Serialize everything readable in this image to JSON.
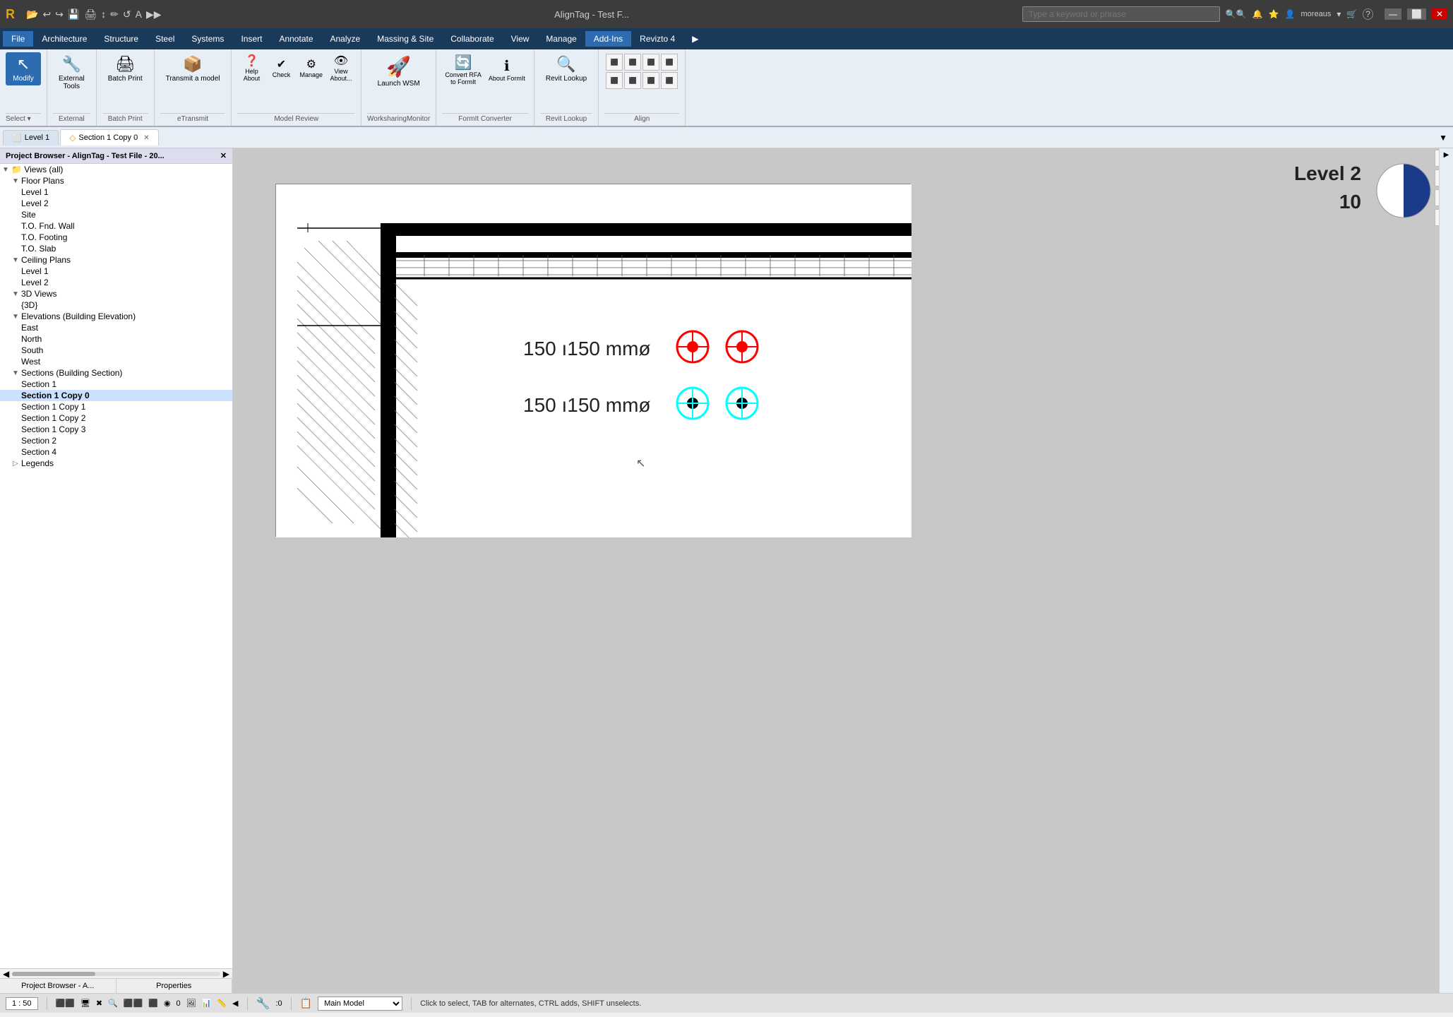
{
  "titleBar": {
    "logo": "R",
    "quickAccessIcons": [
      "↩",
      "↪",
      "🖫",
      "🖨",
      "↕",
      "✏",
      "↺",
      "A",
      "▶▶"
    ],
    "title": "AlignTag - Test F... ",
    "searchPlaceholder": "Type a keyword or phrase",
    "userIcons": [
      "🔍🔍",
      "🔔",
      "⭐",
      "👤",
      "moreaus",
      "▾",
      "🛒",
      "?",
      "—",
      "⬜",
      "✕"
    ],
    "windowControls": [
      "—",
      "⬜",
      "✕"
    ]
  },
  "menuBar": {
    "items": [
      "File",
      "Architecture",
      "Structure",
      "Steel",
      "Systems",
      "Insert",
      "Annotate",
      "Analyze",
      "Massing & Site",
      "Collaborate",
      "View",
      "Manage",
      "Add-Ins",
      "Revizto 4",
      "▶"
    ]
  },
  "ribbon": {
    "activeTab": "Add-Ins",
    "groups": [
      {
        "name": "modify",
        "label": "Select",
        "buttons": [
          {
            "icon": "⬆",
            "label": "Modify",
            "active": true
          }
        ],
        "dropdownLabel": "Select ▾"
      },
      {
        "name": "external",
        "label": "External",
        "buttons": [
          {
            "icon": "🔧",
            "label": "External\nTools"
          }
        ]
      },
      {
        "name": "batchprint",
        "label": "Batch Print",
        "buttons": [
          {
            "icon": "🖨",
            "label": "Batch Print"
          }
        ]
      },
      {
        "name": "etransmit",
        "label": "eTransmit",
        "buttons": [
          {
            "icon": "📦",
            "label": "Transmit a model"
          }
        ]
      },
      {
        "name": "modelreview",
        "label": "Model Review",
        "buttons": [
          {
            "icon": "❓",
            "label": "Help\nAbout"
          },
          {
            "icon": "✔",
            "label": "Check"
          },
          {
            "icon": "⚙",
            "label": "Manage"
          },
          {
            "icon": "👁",
            "label": "View\nAbout..."
          }
        ]
      },
      {
        "name": "worksharingmonitor",
        "label": "WorksharingMonitor",
        "buttons": [
          {
            "icon": "🚀",
            "label": "Launch WSM"
          }
        ]
      },
      {
        "name": "formitconverter",
        "label": "FormIt Converter",
        "buttons": [
          {
            "icon": "🔄",
            "label": "Convert RFA\nto FormIt"
          },
          {
            "icon": "ℹ",
            "label": "About FormIt"
          }
        ]
      },
      {
        "name": "revitlookup",
        "label": "Revit Lookup",
        "buttons": [
          {
            "icon": "🔍",
            "label": "Revit Lookup"
          }
        ]
      },
      {
        "name": "align",
        "label": "Align",
        "buttons": [
          {
            "icon": "⬛",
            "label": ""
          },
          {
            "icon": "⬛",
            "label": ""
          }
        ]
      }
    ]
  },
  "projectBrowser": {
    "title": "Project Browser - AlignTag - Test File - 20...",
    "tree": [
      {
        "level": 0,
        "type": "expand",
        "text": "Views (all)",
        "icon": "▼"
      },
      {
        "level": 1,
        "type": "expand",
        "text": "Floor Plans",
        "icon": "▼"
      },
      {
        "level": 2,
        "type": "leaf",
        "text": "Level 1"
      },
      {
        "level": 2,
        "type": "leaf",
        "text": "Level 2"
      },
      {
        "level": 2,
        "type": "leaf",
        "text": "Site"
      },
      {
        "level": 2,
        "type": "leaf",
        "text": "T.O. Fnd. Wall"
      },
      {
        "level": 2,
        "type": "leaf",
        "text": "T.O. Footing"
      },
      {
        "level": 2,
        "type": "leaf",
        "text": "T.O. Slab"
      },
      {
        "level": 1,
        "type": "expand",
        "text": "Ceiling Plans",
        "icon": "▼"
      },
      {
        "level": 2,
        "type": "leaf",
        "text": "Level 1"
      },
      {
        "level": 2,
        "type": "leaf",
        "text": "Level 2"
      },
      {
        "level": 1,
        "type": "expand",
        "text": "3D Views",
        "icon": "▼"
      },
      {
        "level": 2,
        "type": "leaf",
        "text": "{3D}"
      },
      {
        "level": 1,
        "type": "expand",
        "text": "Elevations (Building Elevation)",
        "icon": "▼"
      },
      {
        "level": 2,
        "type": "leaf",
        "text": "East"
      },
      {
        "level": 2,
        "type": "leaf",
        "text": "North"
      },
      {
        "level": 2,
        "type": "leaf",
        "text": "South"
      },
      {
        "level": 2,
        "type": "leaf",
        "text": "West"
      },
      {
        "level": 1,
        "type": "expand",
        "text": "Sections (Building Section)",
        "icon": "▼"
      },
      {
        "level": 2,
        "type": "leaf",
        "text": "Section 1"
      },
      {
        "level": 2,
        "type": "leaf",
        "text": "Section 1 Copy 0",
        "bold": true,
        "selected": true
      },
      {
        "level": 2,
        "type": "leaf",
        "text": "Section 1 Copy 1"
      },
      {
        "level": 2,
        "type": "leaf",
        "text": "Section 1 Copy 2"
      },
      {
        "level": 2,
        "type": "leaf",
        "text": "Section 1 Copy 3"
      },
      {
        "level": 2,
        "type": "leaf",
        "text": "Section 2"
      },
      {
        "level": 2,
        "type": "leaf",
        "text": "Section 4"
      },
      {
        "level": 1,
        "type": "expand",
        "text": "Legends",
        "icon": "▷"
      }
    ],
    "tabs": [
      "Project Browser - A...",
      "Properties"
    ]
  },
  "viewTabs": [
    {
      "label": "Level 1",
      "icon": "⬜",
      "active": false
    },
    {
      "label": "Section 1 Copy 0",
      "icon": "◇",
      "active": true,
      "closable": true
    }
  ],
  "canvas": {
    "levelLabel": "Level 2",
    "levelNumber": "10",
    "annotation1": "150 ı150 mmø",
    "annotation2": "150 ı150 mmø",
    "scale": "1 : 50"
  },
  "statusBar": {
    "scale": "1 : 50",
    "icons": [
      "⬛⬛",
      "🖥",
      "✖",
      "🔍",
      "⬛⬛",
      "⬛",
      "◉",
      "0",
      "🖼",
      "📊",
      "📏",
      "◀"
    ],
    "coordinateLabel": ":0",
    "modelSelector": "Main Model",
    "statusText": "Click to select, TAB for alternates, CTRL adds, SHIFT unselects."
  }
}
